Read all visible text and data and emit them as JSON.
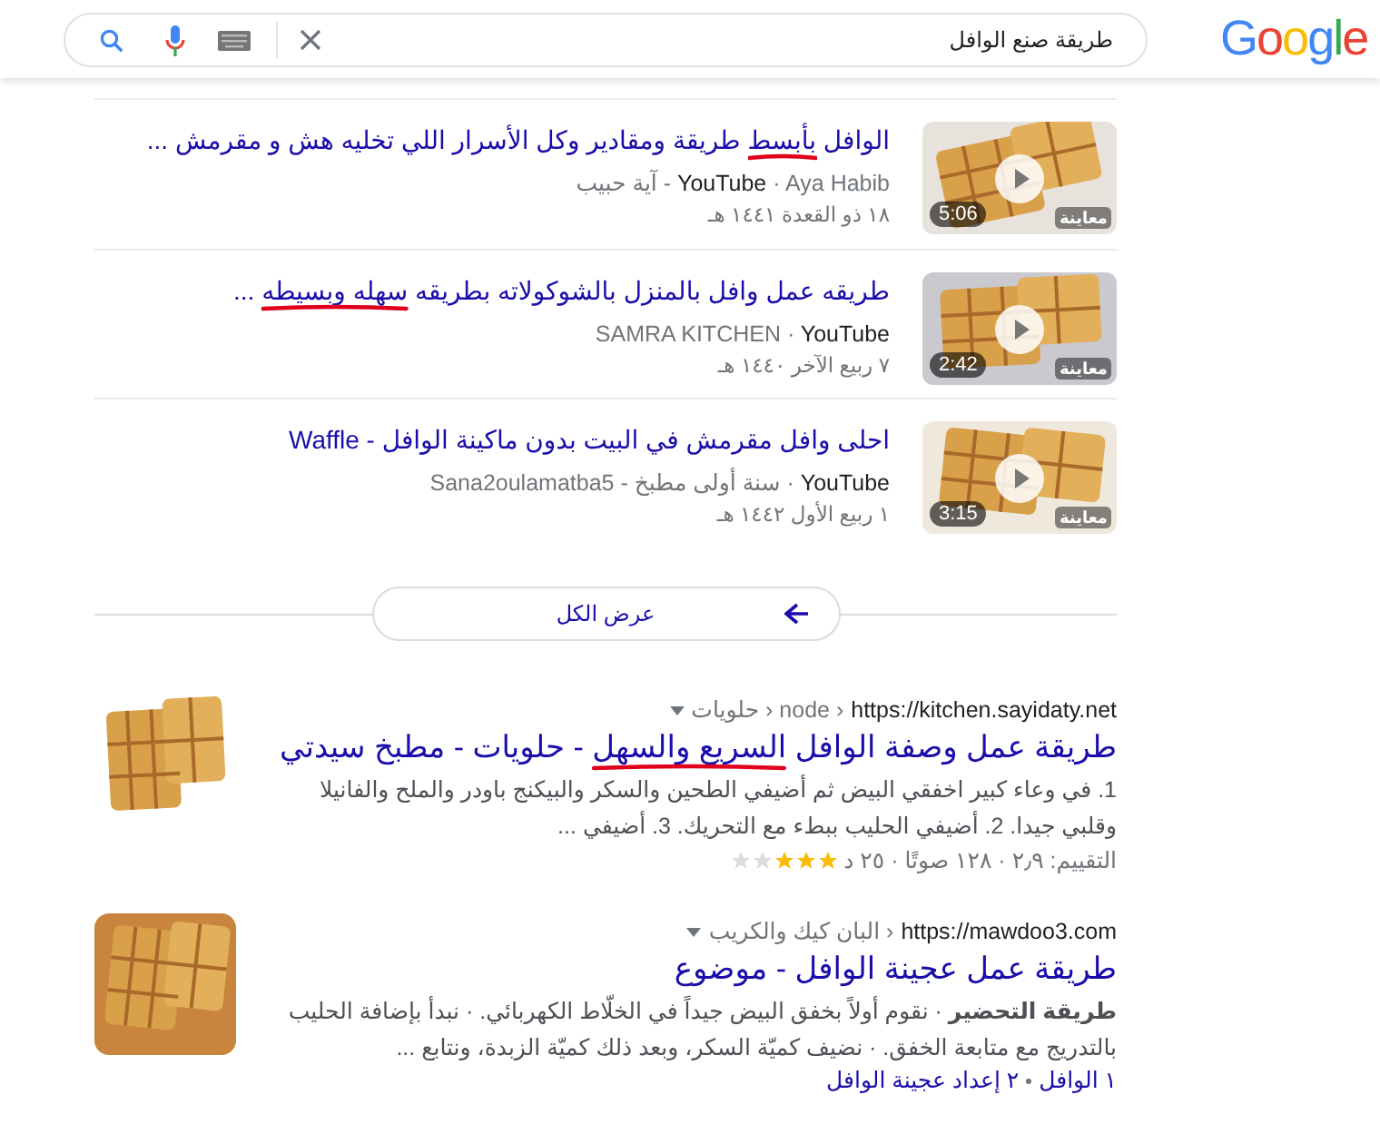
{
  "header": {
    "logo": "Google",
    "search": {
      "value": "طريقة صنع الوافل"
    }
  },
  "videos": [
    {
      "title": [
        {
          "text": "الوافل ",
          "marked": false
        },
        {
          "text": "بأبسط",
          "marked": true
        },
        {
          "text": " طريقة ومقادير وكل الأسرار اللي تخليه هش و مقرمش ...",
          "marked": false
        }
      ],
      "source": "آية حبيب - **YouTube** · Aya Habib",
      "date": "١٨ ذو القعدة ١٤٤١ هـ",
      "duration": "5:06",
      "preview": "معاينة"
    },
    {
      "title": [
        {
          "text": "طريقه عمل وافل بالمنزل بالشوكولاته بطريقه ",
          "marked": false
        },
        {
          "text": "سهله وبسيطه",
          "marked": true
        },
        {
          "text": " ...",
          "marked": false
        }
      ],
      "source": "SAMRA KITCHEN · **YouTube**",
      "date": "٧ ربيع الآخر ١٤٤٠ هـ",
      "duration": "2:42",
      "preview": "معاينة"
    },
    {
      "title": [
        {
          "text": "احلى وافل مقرمش في البيت بدون ماكينة الوافل - Waffle",
          "marked": false
        }
      ],
      "source": "Sana2oulamatba5 - سنة أولى مطبخ · **YouTube**",
      "date": "١ ربيع الأول ١٤٤٢ هـ",
      "duration": "3:15",
      "preview": "معاينة"
    }
  ],
  "view_all": "عرض الكل",
  "results": [
    {
      "url": "https://kitchen.sayidaty.net",
      "path": "حلويات › node ›",
      "title": [
        {
          "text": "طريقة عمل وصفة الوافل ",
          "marked": false
        },
        {
          "text": "السريع والسهل",
          "marked": true
        },
        {
          "text": " - حلويات - مطبخ سيدتي",
          "marked": false
        }
      ],
      "snippet": "1. في وعاء كبير اخفقي البيض ثم أضيفي الطحين والسكر والبيكنج باودر والملح والفانيلا وقلبي جيدا. 2. أضيفي الحليب ببطء مع التحريك. 3. أضيفي ...",
      "rating": {
        "stars": 3,
        "text": "التقييم: ٢٫٩ · ١٢٨ صوتًا · ٢٥ د"
      }
    },
    {
      "url": "https://mawdoo3.com",
      "path": "البان كيك والكريب ›",
      "title": [
        {
          "text": "طريقة عمل عجينة الوافل - موضوع",
          "marked": false
        }
      ],
      "snippet": "**طريقة التحضير** · نقوم أولاً بخفق البيض جيداً في الخلّاط الكهربائي. · نبدأ بإضافة الحليب بالتدريج مع متابعة الخفق. · نضيف كميّة السكر، وبعد ذلك كميّة الزبدة، ونتابع ...",
      "sitelinks": [
        "١ الوافل",
        "٢ إعداد عجينة الوافل"
      ]
    }
  ]
}
